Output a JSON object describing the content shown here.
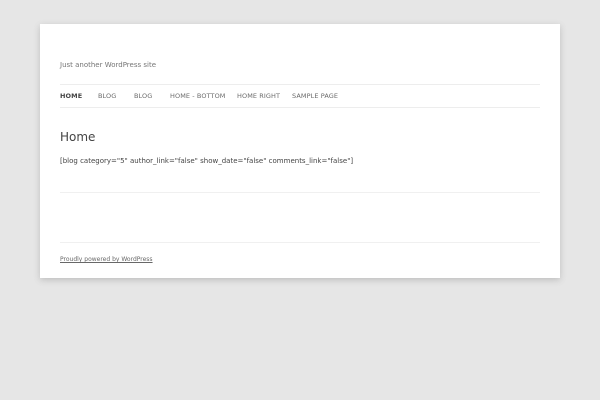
{
  "site": {
    "tagline": "Just another WordPress site"
  },
  "nav": {
    "items": [
      {
        "label": "HOME",
        "current": true
      },
      {
        "label": "BLOG",
        "current": false
      },
      {
        "label": "BLOG",
        "current": false
      },
      {
        "label": "HOME - BOTTOM",
        "current": false
      },
      {
        "label": "HOME RIGHT",
        "current": false
      },
      {
        "label": "SAMPLE PAGE",
        "current": false
      }
    ]
  },
  "main": {
    "title": "Home",
    "content": "[blog category=\"5\" author_link=\"false\" show_date=\"false\" comments_link=\"false\"]"
  },
  "footer": {
    "credit": "Proudly powered by WordPress"
  }
}
